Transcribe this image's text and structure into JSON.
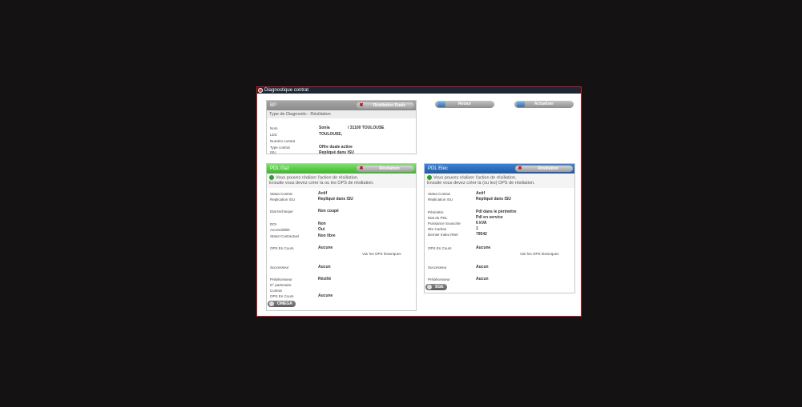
{
  "window": {
    "title": "Diagnostique contrat"
  },
  "bp": {
    "header": "BP",
    "action_label": "Résiliation Duale",
    "diag_type": "Type de Diagnostic : Résiliation",
    "labels": [
      "Nom",
      "LDC",
      "Numéro contrat",
      "Type contrat",
      "ISU"
    ],
    "values": {
      "nom": "Sonia",
      "ville": "/ 31100 TOULOUSE",
      "ldc": "TOULOUSE,",
      "type_contrat": "Offre duale active",
      "isu": "Repliqué dans ISU"
    }
  },
  "top_buttons": {
    "retour": "Retour",
    "actualiser": "Actualiser"
  },
  "gaz": {
    "header": "PDL Gaz",
    "action_label": "Résiliation",
    "message_line1": "Vous pouvez réaliser l'action de résiliation.",
    "message_line2": "Ensuite vous devez créer la ou les OPS de résiliation.",
    "labels": {
      "statut": "Statut Contrat",
      "replication": "Replication ISU",
      "etat_technique": "Etat technique",
      "doi": "DOI",
      "accessibilite": "Accessibilité",
      "statut_contractuel": "Statut Contractuel",
      "ops_en_cours": "OPS En Cours",
      "successeur": "Successeur",
      "predecesseur": "Prédécesseur",
      "partenaire": "N° partenaire",
      "contrat": "Contrat",
      "ops_en_cours2": "OPS En Cours"
    },
    "values": {
      "statut": "Actif",
      "replication": "Repliqué dans ISU",
      "etat_technique": "Non coupé",
      "doi": "Non",
      "accessibilite": "Oui",
      "statut_contractuel": "Non libre",
      "ops_en_cours": "Aucune",
      "successeur": "Aucun",
      "predecesseur": "Résilié",
      "ops_en_cours2": "Aucune"
    },
    "history_link": "Voir les OPS historiques",
    "system_button": "OMEGA"
  },
  "elec": {
    "header": "PDL Elec",
    "action_label": "Résiliation",
    "message_line1": "Vous pouvez réaliser l'action de résiliation.",
    "message_line2": "Ensuite vous devez créer la (ou les) OPS de résiliation.",
    "labels": {
      "statut": "Statut Contrat",
      "replication": "Replication ISU",
      "perimetre": "Périmètre",
      "etat_pdl": "Etat du PDL",
      "puissance": "Puissance Souscrite",
      "nbr_cadran": "Nbr Cadran",
      "dernier_index": "Dernier Index Réel",
      "ops_en_cours": "OPS En Cours",
      "successeur": "Successeur",
      "predecesseur": "Prédécesseur"
    },
    "values": {
      "statut": "Actif",
      "replication": "Repliqué dans ISU",
      "perimetre": "Pdl dans le périmètre",
      "etat_pdl": "Pdl en service",
      "puissance": "6 kVA",
      "nbr_cadran": "1",
      "dernier_index": "79542",
      "ops_en_cours": "Aucune",
      "successeur": "Aucun",
      "predecesseur": "Aucun"
    },
    "history_link": "Voir les OPS historiques",
    "system_button": "SGE"
  }
}
